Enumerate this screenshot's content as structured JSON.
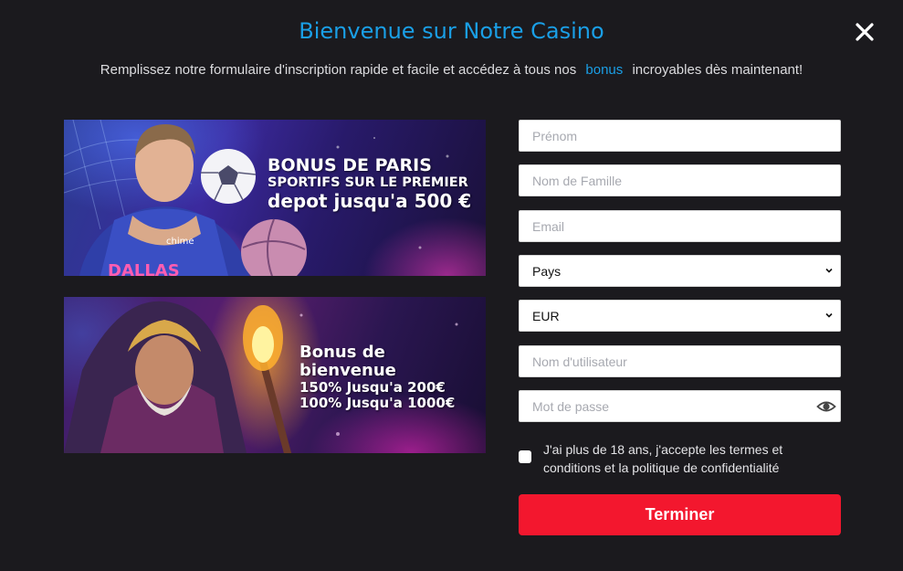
{
  "modal": {
    "title": "Bienvenue sur Notre Casino",
    "subtitle_before": "Remplissez notre formulaire d'inscription rapide et facile et accédez à tous nos",
    "subtitle_highlight": "bonus",
    "subtitle_after": "incroyables dès maintenant!",
    "close_icon": "close-icon"
  },
  "banners": [
    {
      "line1": "BONUS DE PARIS",
      "line2": "SPORTIFS SUR LE PREMIER",
      "line3": "depot jusqu'a 500 €"
    },
    {
      "line1": "Bonus de bienvenue",
      "line2": "150% Jusqu'a 200€",
      "line3": "100% Jusqu'a 1000€"
    }
  ],
  "form": {
    "first_name": {
      "placeholder": "Prénom",
      "value": ""
    },
    "last_name": {
      "placeholder": "Nom de Famille",
      "value": ""
    },
    "email": {
      "placeholder": "Email",
      "value": ""
    },
    "country": {
      "selected": "Pays"
    },
    "currency": {
      "selected": "EUR"
    },
    "username": {
      "placeholder": "Nom d'utilisateur",
      "value": ""
    },
    "password": {
      "placeholder": "Mot de passe",
      "value": "",
      "icon": "eye-icon"
    },
    "terms_label": "J'ai plus de 18 ans, j'accepte les termes et conditions et la politique de confidentialité",
    "terms_checked": false,
    "submit_label": "Terminer"
  },
  "colors": {
    "background": "#1b1a1e",
    "accent": "#1a9fe6",
    "submit": "#f3172e"
  }
}
